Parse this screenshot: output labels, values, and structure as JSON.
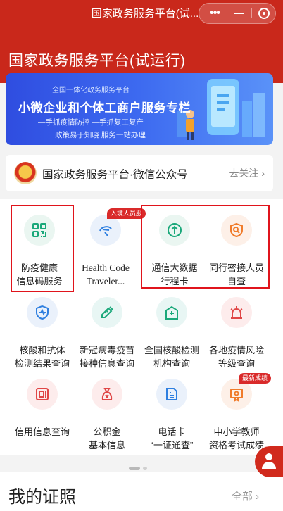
{
  "nav": {
    "title": "国家政务服务平台(试..."
  },
  "page": {
    "title": "国家政务服务平台(试运行)"
  },
  "banner": {
    "top_text": "全国一体化政务服务平台",
    "main_text": "小微企业和个体工商户服务专栏",
    "line1": "—手抓疫情防控  —手抓复工复产",
    "line2": "政策易于知晓 服务一站办理"
  },
  "account": {
    "name": "国家政务服务平台·微信公众号",
    "follow": "去关注 ›"
  },
  "services": [
    {
      "label": "防疫健康\n信息码服务",
      "icon": "qr-code-icon",
      "color": "#1aa87a"
    },
    {
      "label": "Health Code\nTraveler...",
      "icon": "airplane-icon",
      "color": "#2e7fe0",
      "badge": "入境人员服"
    },
    {
      "label": "通信大数据\n行程卡",
      "icon": "arrow-up-circle-icon",
      "color": "#1aa87a"
    },
    {
      "label": "同行密接人员\n自查",
      "icon": "shield-search-icon",
      "color": "#f07b2a"
    },
    {
      "label": "核酸和抗体\n检测结果查询",
      "icon": "shield-pulse-icon",
      "color": "#2e7fe0"
    },
    {
      "label": "新冠病毒疫苗\n接种信息查询",
      "icon": "syringe-icon",
      "color": "#1aa87a"
    },
    {
      "label": "全国核酸检测\n机构查询",
      "icon": "hospital-icon",
      "color": "#1aa87a"
    },
    {
      "label": "各地疫情风险\n等级查询",
      "icon": "alarm-icon",
      "color": "#e04646"
    },
    {
      "label": "信用信息查询",
      "icon": "credit-book-icon",
      "color": "#e04646"
    },
    {
      "label": "公积金\n基本信息",
      "icon": "money-bag-icon",
      "color": "#e04646"
    },
    {
      "label": "电话卡\n“一证通查”",
      "icon": "sim-card-icon",
      "color": "#2e7fe0"
    },
    {
      "label": "中小学教师\n资格考试成绩",
      "icon": "certificate-icon",
      "color": "#f07b2a",
      "badge": "最新成绩"
    }
  ],
  "section": {
    "title": "我的证照",
    "more": "全部 ›"
  }
}
